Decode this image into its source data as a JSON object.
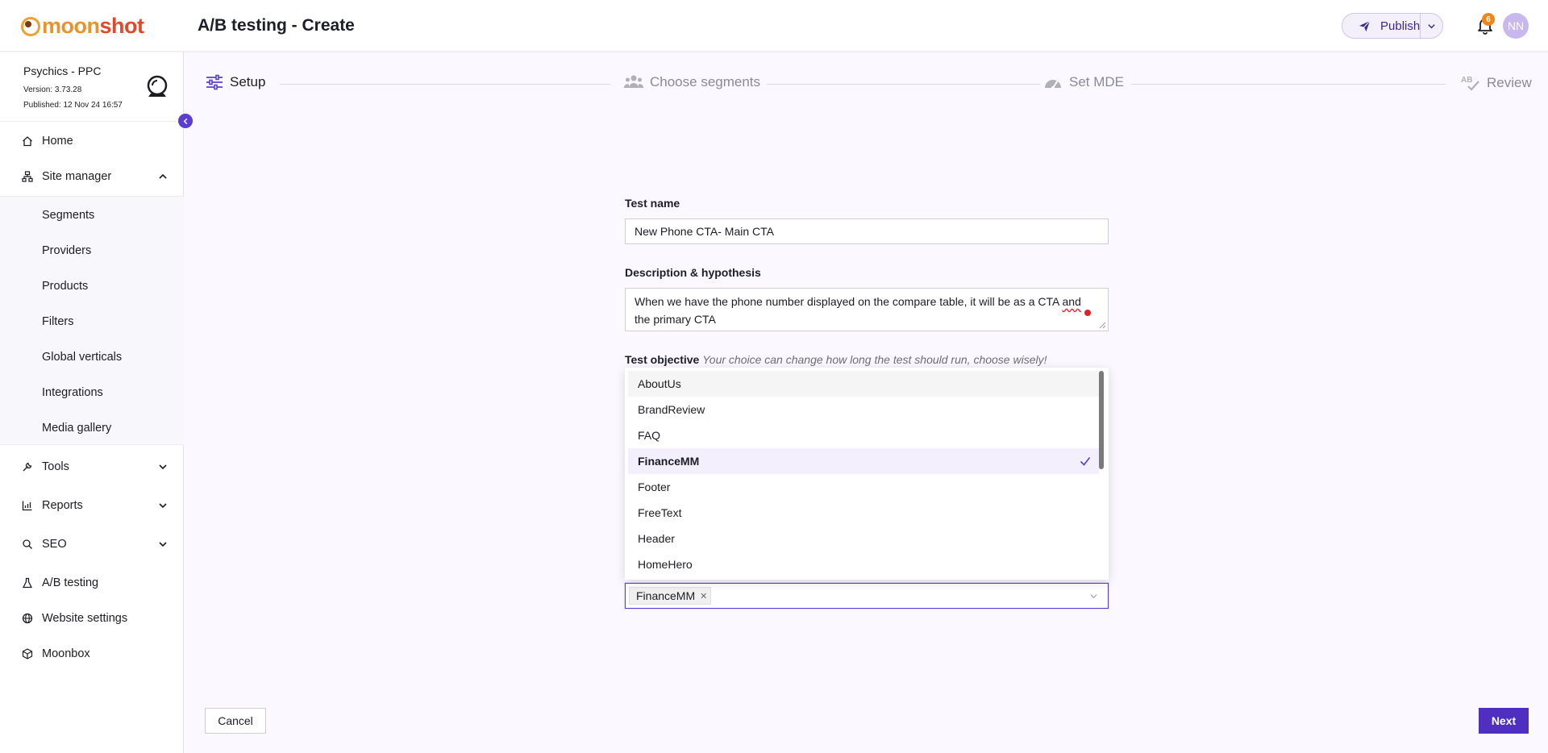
{
  "brand": {
    "logo_text_a": "moon",
    "logo_text_b": "shot"
  },
  "header": {
    "title": "A/B testing - Create",
    "publish_label": "Publish",
    "notification_count": "6",
    "avatar_initials": "NN"
  },
  "site": {
    "name": "Psychics - PPC",
    "version": "Version: 3.73.28",
    "published": "Published: 12 Nov 24 16:57"
  },
  "sidebar": {
    "items": [
      {
        "label": "Home",
        "icon": "home-icon"
      },
      {
        "label": "Site manager",
        "icon": "sitemap-icon"
      },
      {
        "label": "Tools",
        "icon": "wrench-icon"
      },
      {
        "label": "Reports",
        "icon": "chart-icon"
      },
      {
        "label": "SEO",
        "icon": "search-icon"
      },
      {
        "label": "A/B testing",
        "icon": "flask-icon"
      },
      {
        "label": "Website settings",
        "icon": "globe-icon"
      },
      {
        "label": "Moonbox",
        "icon": "box-icon"
      }
    ],
    "sub_items": [
      "Segments",
      "Providers",
      "Products",
      "Filters",
      "Global verticals",
      "Integrations",
      "Media gallery"
    ]
  },
  "stepper": {
    "steps": [
      {
        "label": "Setup",
        "state": "active"
      },
      {
        "label": "Choose segments",
        "state": "inactive"
      },
      {
        "label": "Set MDE",
        "state": "inactive"
      },
      {
        "label": "Review",
        "state": "inactive"
      }
    ]
  },
  "form": {
    "test_name_label": "Test name",
    "test_name_value": "New Phone CTA- Main CTA",
    "description_label": "Description & hypothesis",
    "description_before": "When we have the phone number displayed on the compare table, it will be as a CTA ",
    "description_misspelled": "and",
    "description_after": " the primary CTA",
    "objective_label": "Test objective",
    "objective_hint": "Your choice can change how long the test should run, choose wisely!"
  },
  "dropdown": {
    "options": [
      "AboutUs",
      "BrandReview",
      "FAQ",
      "FinanceMM",
      "Footer",
      "FreeText",
      "Header",
      "HomeHero"
    ],
    "hovered": "AboutUs",
    "selected": "FinanceMM",
    "selected_tag": "FinanceMM"
  },
  "footer": {
    "cancel_label": "Cancel",
    "next_label": "Next"
  },
  "colors": {
    "accent": "#4f2fbf",
    "accent_light": "#f3effd",
    "badge": "#f0861a"
  }
}
